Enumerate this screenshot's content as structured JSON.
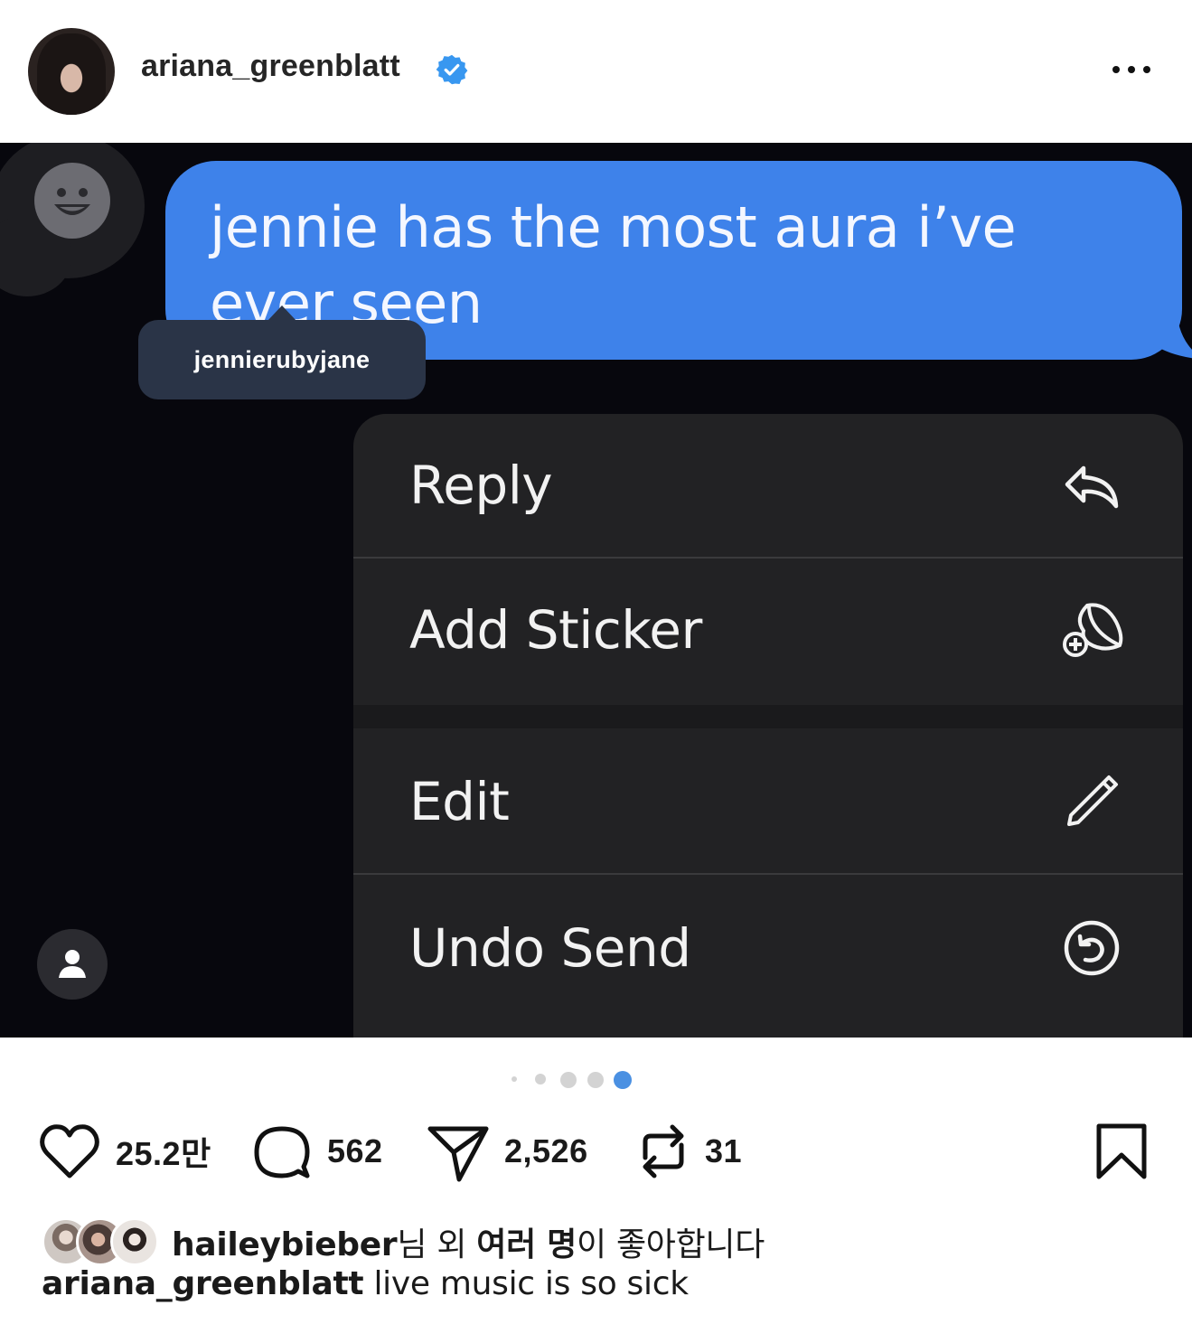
{
  "header": {
    "username": "ariana_greenblatt",
    "verified": true,
    "more_icon": "more-horizontal-icon"
  },
  "media": {
    "message_text": "jennie has the most aura i’ve ever seen",
    "bubble_color": "#3e82ea",
    "tag_username": "jennierubyjane",
    "context_menu": [
      {
        "label": "Reply",
        "icon": "reply-icon"
      },
      {
        "label": "Add Sticker",
        "icon": "add-sticker-icon"
      },
      {
        "label": "Edit",
        "icon": "pencil-icon"
      },
      {
        "label": "Undo Send",
        "icon": "undo-send-icon"
      }
    ]
  },
  "carousel": {
    "total_dots": 5,
    "active_index": 4,
    "active_color": "#4a90e2"
  },
  "actions": {
    "likes": "25.2만",
    "comments": "562",
    "shares": "2,526",
    "reposts": "31"
  },
  "liked_by": {
    "first_user": "haileybieber",
    "suffix_1": "님 외 ",
    "bold_others": "여러 명",
    "suffix_2": "이 좋아합니다"
  },
  "caption": {
    "username": "ariana_greenblatt",
    "text": " live music is so sick"
  }
}
